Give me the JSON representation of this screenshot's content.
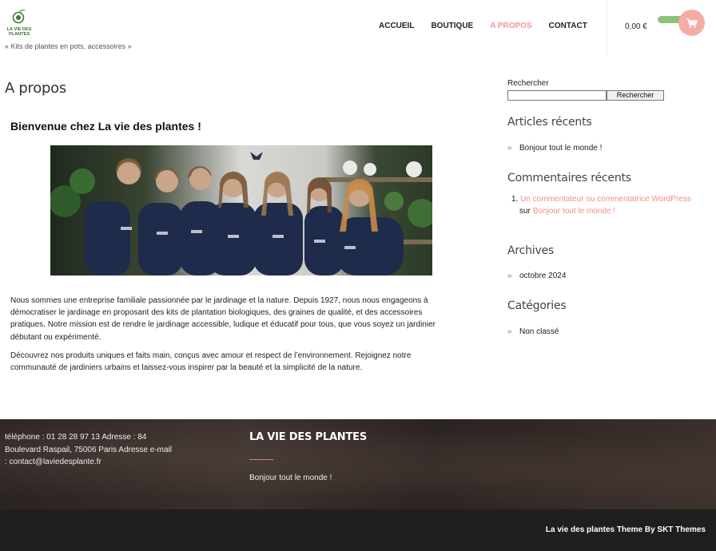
{
  "header": {
    "logo_lines": [
      "LA VIE DES",
      "PLANTES"
    ],
    "tagline": "« Kits de plantes en pots, accessoires »",
    "nav": [
      {
        "label": "ACCUEIL",
        "active": false
      },
      {
        "label": "BOUTIQUE",
        "active": false
      },
      {
        "label": "A PROPOS",
        "active": true
      },
      {
        "label": "CONTACT",
        "active": false
      }
    ],
    "cart_amount": "0,00 €"
  },
  "main": {
    "page_title": "A propos",
    "heading": "Bienvenue chez La vie des plantes !",
    "paragraphs": [
      "Nous sommes une entreprise familiale passionnée par le jardinage et la nature. Depuis 1927, nous nous engageons à démocratiser le jardinage en proposant des kits de plantation biologiques, des graines de qualité, et des accessoires pratiques. Notre mission est de rendre le jardinage accessible, ludique et éducatif pour tous, que vous soyez un jardinier débutant ou expérimenté.",
      "Découvrez nos produits uniques et faits main, conçus avec amour et respect de l’environnement. Rejoignez notre communauté de jardiniers urbains et laissez-vous inspirer par la beauté et la simplicité de la nature."
    ]
  },
  "sidebar": {
    "search_label": "Rechercher",
    "search_value": "",
    "search_button": "Rechercher",
    "recent_posts_title": "Articles récents",
    "recent_posts": [
      "Bonjour tout le monde !"
    ],
    "recent_comments_title": "Commentaires récents",
    "comment": {
      "number": "1.",
      "author": "Un commentateur ou commentatrice WordPress",
      "joiner": "sur",
      "post": "Bonjour tout le monde !"
    },
    "archives_title": "Archives",
    "archives": [
      "octobre 2024"
    ],
    "categories_title": "Catégories",
    "categories": [
      "Non classé"
    ]
  },
  "footer": {
    "contact": "téléphone : 01 28 28 97 13 Adresse : 84 Boulevard Raspail, 75006 Paris Adresse e-mail : contact@laviedesplante.fr",
    "title": "LA VIE DES PLANTES",
    "link": "Bonjour tout le monde !",
    "credit": "La vie des plantes Theme By SKT Themes"
  },
  "colors": {
    "accent": "#ef9a8f",
    "cart_button": "#f2aea6",
    "cart_pill": "#8cc37a",
    "footer_bg": "#2e2624",
    "bottom_bar": "#1f1f1f"
  }
}
